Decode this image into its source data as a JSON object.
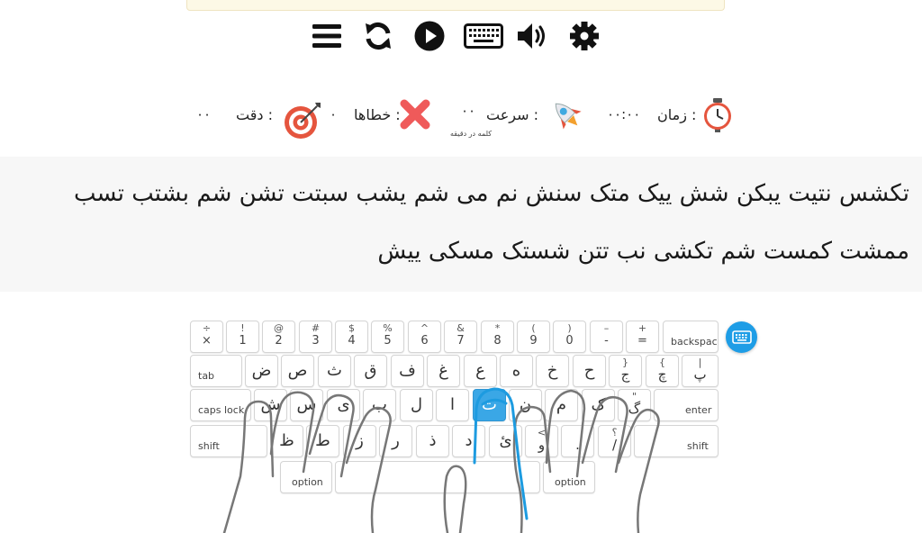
{
  "toolbar": {
    "icons": [
      "menu-icon",
      "refresh-icon",
      "play-icon",
      "keyboard-icon",
      "volume-icon",
      "gear-icon"
    ]
  },
  "stats": {
    "time": {
      "label": "زمان :",
      "value": "۰۰:۰۰"
    },
    "speed": {
      "label": "سرعت :",
      "value": "۰۰",
      "unit": "کلمه در دقیقه"
    },
    "errors": {
      "label": "خطاها :",
      "value": "۰"
    },
    "accuracy": {
      "label": "دقت :",
      "value": "۰۰"
    }
  },
  "typing_text": {
    "line1": "تکشس نتیت یبکن شش ییک متک سنش نم می شم یشب سبتت تشن شم بشتب تسب",
    "line2": "ممشت کمست شم تکشی نب تتن شستک مسکی ییش"
  },
  "keyboard": {
    "row1": [
      {
        "s": "÷",
        "m": "×"
      },
      {
        "s": "!",
        "m": "1"
      },
      {
        "s": "@",
        "m": "2"
      },
      {
        "s": "#",
        "m": "3"
      },
      {
        "s": "$",
        "m": "4"
      },
      {
        "s": "%",
        "m": "5"
      },
      {
        "s": "^",
        "m": "6"
      },
      {
        "s": "&",
        "m": "7"
      },
      {
        "s": "*",
        "m": "8"
      },
      {
        "s": "(",
        "m": "9"
      },
      {
        "s": ")",
        "m": "0"
      },
      {
        "s": "–",
        "m": "-"
      },
      {
        "s": "+",
        "m": "="
      }
    ],
    "backspace": "backspace",
    "tab": "tab",
    "row2": [
      "ض",
      "ص",
      "ث",
      "ق",
      "ف",
      "غ",
      "ع",
      "ه",
      "خ",
      "ح"
    ],
    "row2_extra": [
      {
        "s": "}",
        "m": "ج"
      },
      {
        "s": "{",
        "m": "چ"
      },
      {
        "s": "|",
        "m": "پ"
      }
    ],
    "caps_lock": "caps lock",
    "row3": [
      "ش",
      "س",
      "ی",
      "ب",
      "ل",
      "ا",
      "ت",
      "ن",
      "م",
      "ک",
      "گ"
    ],
    "row3_extra_top": "\"",
    "enter": "enter",
    "shift": "shift",
    "row4": [
      "ظ",
      "ط",
      "ز",
      "ر",
      "ذ",
      "د",
      "ئ",
      "و",
      ".",
      "/"
    ],
    "row4_top": {
      "key8": "<",
      "key10": "؟"
    },
    "option": "option",
    "active_key": "ت"
  }
}
